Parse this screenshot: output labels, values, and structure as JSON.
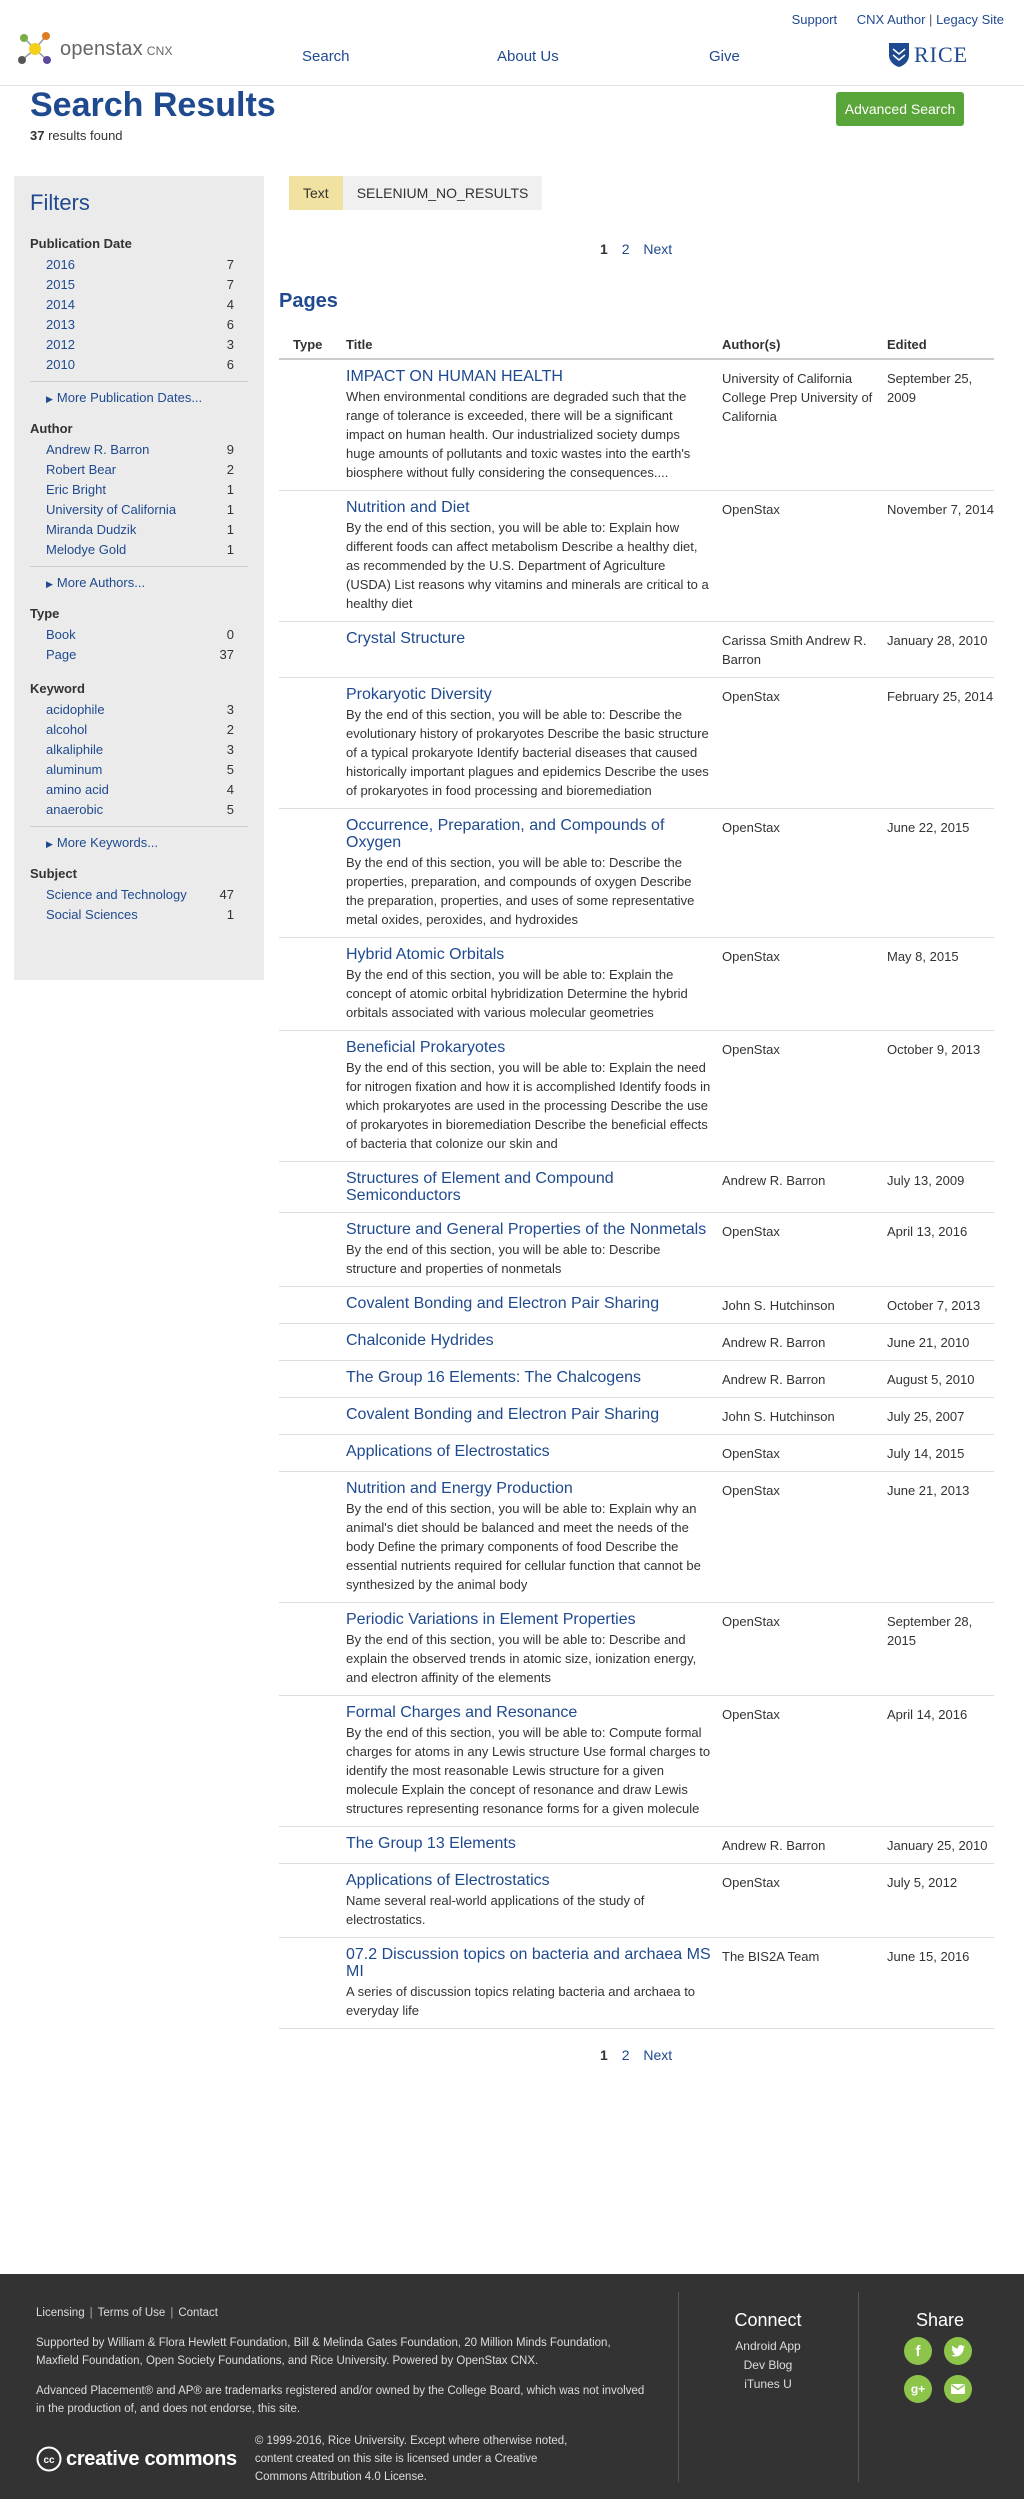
{
  "header": {
    "utility_links": [
      "Support",
      "CNX Author",
      "Legacy Site"
    ],
    "utility_sep": "|",
    "logo_text": "openstax",
    "logo_suffix": "CNX",
    "nav": [
      "Search",
      "About Us",
      "Give"
    ],
    "partner_logo": "RICE"
  },
  "page": {
    "title": "Search Results",
    "count": "37",
    "count_label": "results found",
    "advanced_search": "Advanced Search"
  },
  "filters": {
    "heading": "Filters",
    "groups": [
      {
        "title": "Publication Date",
        "items": [
          {
            "label": "2016",
            "count": "7"
          },
          {
            "label": "2015",
            "count": "7"
          },
          {
            "label": "2014",
            "count": "4"
          },
          {
            "label": "2013",
            "count": "6"
          },
          {
            "label": "2012",
            "count": "3"
          },
          {
            "label": "2010",
            "count": "6"
          }
        ],
        "more": "More Publication Dates..."
      },
      {
        "title": "Author",
        "items": [
          {
            "label": "Andrew R. Barron",
            "count": "9"
          },
          {
            "label": "Robert Bear",
            "count": "2"
          },
          {
            "label": "Eric Bright",
            "count": "1"
          },
          {
            "label": "University of California",
            "count": "1"
          },
          {
            "label": "Miranda Dudzik",
            "count": "1"
          },
          {
            "label": "Melodye Gold",
            "count": "1"
          }
        ],
        "more": "More Authors..."
      },
      {
        "title": "Type",
        "items": [
          {
            "label": "Book",
            "count": "0"
          },
          {
            "label": "Page",
            "count": "37"
          }
        ],
        "more": ""
      },
      {
        "title": "Keyword",
        "items": [
          {
            "label": "acidophile",
            "count": "3"
          },
          {
            "label": "alcohol",
            "count": "2"
          },
          {
            "label": "alkaliphile",
            "count": "3"
          },
          {
            "label": "aluminum",
            "count": "5"
          },
          {
            "label": "amino acid",
            "count": "4"
          },
          {
            "label": "anaerobic",
            "count": "5"
          }
        ],
        "more": "More Keywords..."
      },
      {
        "title": "Subject",
        "items": [
          {
            "label": "Science and Technology",
            "count": "47"
          },
          {
            "label": "Social Sciences",
            "count": "1"
          }
        ],
        "more": ""
      }
    ]
  },
  "search_tabs": {
    "active": "Text",
    "term": "SELENIUM_NO_RESULTS"
  },
  "pagination": {
    "current": "1",
    "page2": "2",
    "next": "Next"
  },
  "results": {
    "section": "Pages",
    "columns": {
      "type": "Type",
      "title": "Title",
      "authors": "Author(s)",
      "edited": "Edited"
    },
    "rows": [
      {
        "title": "IMPACT ON HUMAN HEALTH",
        "desc": "When environmental conditions are degraded such that the range of tolerance is exceeded, there will be a significant impact on human health. Our industrialized society dumps huge amounts of pollutants and toxic wastes into the earth's biosphere without fully considering the consequences....",
        "authors": "University of California College Prep University of California",
        "edited": "September 25, 2009"
      },
      {
        "title": "Nutrition and Diet",
        "desc": "By the end of this section, you will be able to: Explain how different foods can affect metabolism Describe a healthy diet, as recommended by the U.S. Department of Agriculture (USDA) List reasons why vitamins and minerals are critical to a healthy diet",
        "authors": "OpenStax",
        "edited": "November 7, 2014"
      },
      {
        "title": "Crystal Structure",
        "desc": "",
        "authors": "Carissa Smith Andrew R. Barron",
        "edited": "January 28, 2010"
      },
      {
        "title": "Prokaryotic Diversity",
        "desc": "By the end of this section, you will be able to: Describe the evolutionary history of prokaryotes Describe the basic structure of a typical prokaryote Identify bacterial diseases that caused historically important plagues and epidemics Describe the uses of prokaryotes in food processing and bioremediation",
        "authors": "OpenStax",
        "edited": "February 25, 2014"
      },
      {
        "title": "Occurrence, Preparation, and Compounds of Oxygen",
        "desc": "By the end of this section, you will be able to: Describe the properties, preparation, and compounds of oxygen Describe the preparation, properties, and uses of some representative metal oxides, peroxides, and hydroxides",
        "authors": "OpenStax",
        "edited": "June 22, 2015"
      },
      {
        "title": "Hybrid Atomic Orbitals",
        "desc": "By the end of this section, you will be able to: Explain the concept of atomic orbital hybridization Determine the hybrid orbitals associated with various molecular geometries",
        "authors": "OpenStax",
        "edited": "May 8, 2015"
      },
      {
        "title": "Beneficial Prokaryotes",
        "desc": "By the end of this section, you will be able to: Explain the need for nitrogen fixation and how it is accomplished Identify foods in which prokaryotes are used in the processing Describe the use of prokaryotes in bioremediation Describe the beneficial effects of bacteria that colonize our skin and",
        "authors": "OpenStax",
        "edited": "October 9, 2013"
      },
      {
        "title": "Structures of Element and Compound Semiconductors",
        "desc": "",
        "authors": "Andrew R. Barron",
        "edited": "July 13, 2009"
      },
      {
        "title": "Structure and General Properties of the Nonmetals",
        "desc": "By the end of this section, you will be able to: Describe structure and properties of nonmetals",
        "authors": "OpenStax",
        "edited": "April 13, 2016"
      },
      {
        "title": "Covalent Bonding and Electron Pair Sharing",
        "desc": "",
        "authors": "John S. Hutchinson",
        "edited": "October 7, 2013"
      },
      {
        "title": "Chalconide Hydrides",
        "desc": "",
        "authors": "Andrew R. Barron",
        "edited": "June 21, 2010"
      },
      {
        "title": "The Group 16 Elements: The Chalcogens",
        "desc": "",
        "authors": "Andrew R. Barron",
        "edited": "August 5, 2010"
      },
      {
        "title": "Covalent Bonding and Electron Pair Sharing",
        "desc": "",
        "authors": "John S. Hutchinson",
        "edited": "July 25, 2007"
      },
      {
        "title": "Applications of Electrostatics",
        "desc": "",
        "authors": "OpenStax",
        "edited": "July 14, 2015"
      },
      {
        "title": "Nutrition and Energy Production",
        "desc": "By the end of this section, you will be able to: Explain why an animal's diet should be balanced and meet the needs of the body Define the primary components of food Describe the essential nutrients required for cellular function that cannot be synthesized by the animal body",
        "authors": "OpenStax",
        "edited": "June 21, 2013"
      },
      {
        "title": "Periodic Variations in Element Properties",
        "desc": "By the end of this section, you will be able to: Describe and explain the observed trends in atomic size, ionization energy, and electron affinity of the elements",
        "authors": "OpenStax",
        "edited": "September 28, 2015"
      },
      {
        "title": "Formal Charges and Resonance",
        "desc": "By the end of this section, you will be able to: Compute formal charges for atoms in any Lewis structure Use formal charges to identify the most reasonable Lewis structure for a given molecule Explain the concept of resonance and draw Lewis structures representing resonance forms for a given molecule",
        "authors": "OpenStax",
        "edited": "April 14, 2016"
      },
      {
        "title": "The Group 13 Elements",
        "desc": "",
        "authors": "Andrew R. Barron",
        "edited": "January 25, 2010"
      },
      {
        "title": "Applications of Electrostatics",
        "desc": "Name several real-world applications of the study of electrostatics.",
        "authors": "OpenStax",
        "edited": "July 5, 2012"
      },
      {
        "title": "07.2 Discussion topics on bacteria and archaea MS MI",
        "desc": "A series of discussion topics relating bacteria and archaea to everyday life",
        "authors": "The BIS2A Team",
        "edited": "June 15, 2016"
      }
    ]
  },
  "footer": {
    "links": [
      "Licensing",
      "Terms of Use",
      "Contact"
    ],
    "supported": "Supported by William & Flora Hewlett Foundation, Bill & Melinda Gates Foundation, 20 Million Minds Foundation, Maxfield Foundation, Open Society Foundations, and Rice University. Powered by OpenStax CNX.",
    "ap_notice": "Advanced Placement® and AP® are trademarks registered and/or owned by the College Board, which was not involved in the production of, and does not endorse, this site.",
    "cc_word": "creative commons",
    "copyright": "© 1999-2016, Rice University. Except where otherwise noted, content created on this site is licensed under a Creative Commons Attribution 4.0 License.",
    "connect_title": "Connect",
    "connect_links": [
      "Android App",
      "Dev Blog",
      "iTunes U"
    ],
    "share_title": "Share",
    "accent_color": "#8dc54b"
  }
}
